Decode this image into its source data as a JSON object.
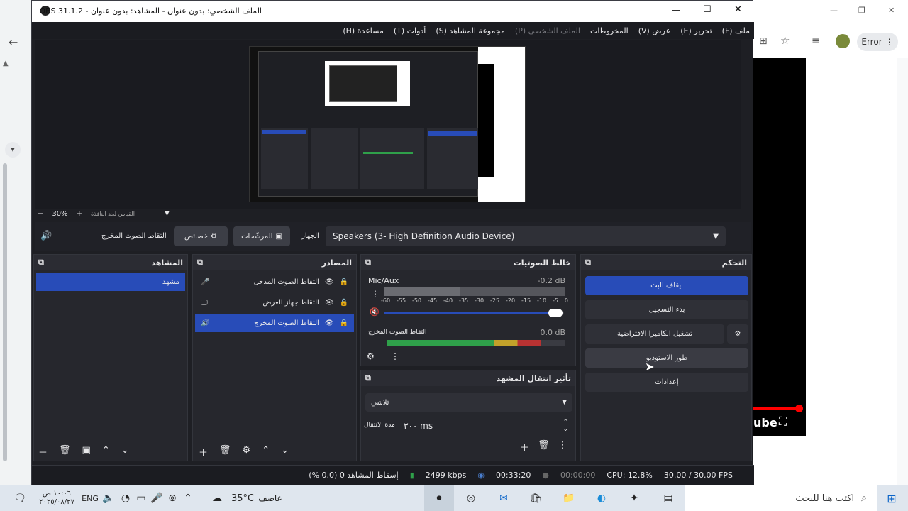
{
  "window": {
    "title": "الملف الشخصي: بدون عنوان - المشاهد: بدون عنوان - OBS 31.1.2",
    "obs_logo": "obs-logo-icon",
    "minimize": "—",
    "maximize": "☐",
    "close": "✕"
  },
  "menu": [
    {
      "label": "ملف (F)",
      "enabled": true
    },
    {
      "label": "تحرير (E)",
      "enabled": true
    },
    {
      "label": "عرض (V)",
      "enabled": true
    },
    {
      "label": "المخروطات",
      "enabled": true
    },
    {
      "label": "الملف الشخصي (P)",
      "enabled": false
    },
    {
      "label": "مجموعة المشاهد (S)",
      "enabled": true
    },
    {
      "label": "أدوات (T)",
      "enabled": true
    },
    {
      "label": "مساعدة (H)",
      "enabled": true
    }
  ],
  "preview": {
    "zoom": "30%",
    "zoom_minus": "−",
    "zoom_plus": "+",
    "fit_label": "القياس لحد النافذة"
  },
  "audio_bar": {
    "source_name": "التقاط الصوت المخرج",
    "properties": "خصائص",
    "filters": "المرشّحات",
    "device_label": "الجهاز",
    "device_value": "Speakers (3- High Definition Audio Device)"
  },
  "scenes": {
    "title": "المشاهد",
    "items": [
      "مشهد"
    ]
  },
  "sources": {
    "title": "المصادر",
    "items": [
      {
        "name": "التقاط الصوت المدخل",
        "icon": "microphone-icon",
        "selected": false
      },
      {
        "name": "التقاط جهاز العرض",
        "icon": "monitor-icon",
        "selected": false
      },
      {
        "name": "التقاط الصوت المخرج",
        "icon": "speaker-icon",
        "selected": true
      }
    ]
  },
  "mixer": {
    "title": "خالط الصوتيات",
    "channels": [
      {
        "name": "Mic/Aux",
        "db": "-0.2 dB",
        "level": 0.42,
        "volume": 0.97
      },
      {
        "name": "التقاط الصوت المخرج",
        "db": "0.0 dB",
        "level": 0.86
      }
    ],
    "ticks": [
      "-60",
      "-55",
      "-50",
      "-45",
      "-40",
      "-35",
      "-30",
      "-25",
      "-20",
      "-15",
      "-10",
      "-5",
      "0"
    ]
  },
  "transitions": {
    "title": "تأثير انتقال المشهد",
    "selected": "تلاشي",
    "duration_label": "مدة الانتقال",
    "duration_value": "٣٠٠ ms"
  },
  "controls": {
    "title": "التحكم",
    "stop_stream": "ايقاف البث",
    "start_record": "بدء التسجيل",
    "virtual_cam": "تشغيل الكاميرا الافتراضية",
    "studio_mode": "طور الاستوديو",
    "settings": "إعدادات"
  },
  "status": {
    "dropped": "إسقاط المشاهد 0 (0.0 %)",
    "bitrate": "2499 kbps",
    "stream_time": "00:33:20",
    "rec_time": "00:00:00",
    "cpu": "CPU: 12.8%",
    "fps": "30.00 / 30.00 FPS"
  },
  "browser": {
    "error_label": "Error",
    "yt_text": "ube"
  },
  "taskbar": {
    "search_placeholder": "اكتب هنا للبحث",
    "weather_temp": "35°C",
    "weather_desc": "عاصف",
    "lang": "ENG",
    "time": "١٠:٠٦ ص",
    "date": "٢٠٢٥/٠٨/٢٧"
  },
  "colors": {
    "accent": "#284cb8",
    "bg": "#1e1f24",
    "meter_green": "#2fa04a",
    "meter_yellow": "#c2a12a",
    "meter_red": "#b83232"
  }
}
